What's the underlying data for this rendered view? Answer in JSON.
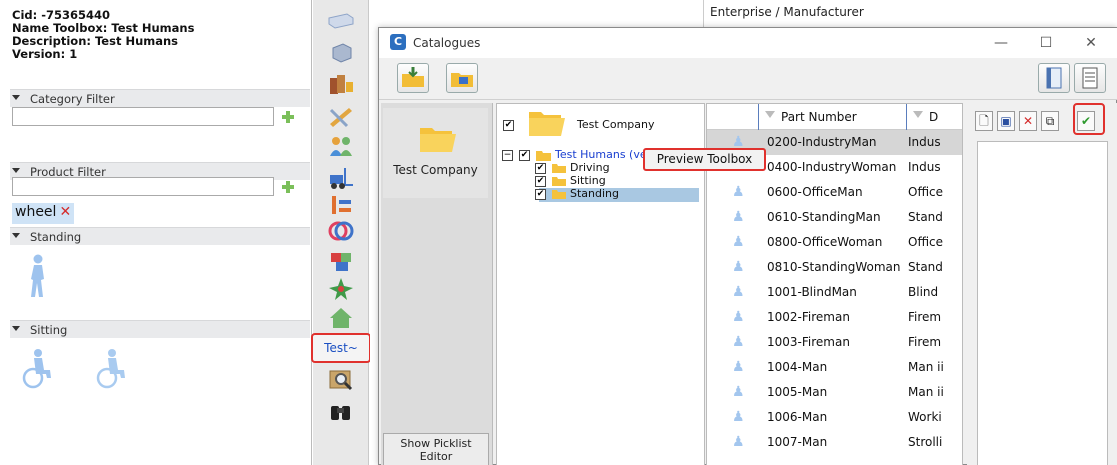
{
  "toolbox": {
    "cid": "Cid: -75365440",
    "name_toolbox": "Name Toolbox: Test Humans",
    "description": "Description: Test Humans",
    "version": "Version: 1",
    "category_filter": "Category Filter",
    "product_filter": "Product Filter",
    "tag": "wheel",
    "standing": "Standing",
    "sitting": "Sitting"
  },
  "strip": {
    "test_tab": "Test~"
  },
  "bg_window": {
    "enterprise": "Enterprise / Manufacturer"
  },
  "catalogues": {
    "title": "Catalogues",
    "minimize": "—",
    "maximize": "☐",
    "close": "✕",
    "company_button": "Test Company",
    "picklist_button_line1": "Show Picklist",
    "picklist_button_line2": "Editor",
    "tree": {
      "root": "Test Company",
      "toolbox": "Test Humans (version 1)",
      "children": [
        "Driving",
        "Sitting",
        "Standing"
      ]
    },
    "context_menu": "Preview Toolbox",
    "grid": {
      "col_part_number": "Part Number",
      "col_desc": "D",
      "rows": [
        {
          "part": "0200-IndustryMan",
          "desc": "Indus"
        },
        {
          "part": "0400-IndustryWoman",
          "desc": "Indus"
        },
        {
          "part": "0600-OfficeMan",
          "desc": "Office"
        },
        {
          "part": "0610-StandingMan",
          "desc": "Stand"
        },
        {
          "part": "0800-OfficeWoman",
          "desc": "Office"
        },
        {
          "part": "0810-StandingWoman",
          "desc": "Stand"
        },
        {
          "part": "1001-BlindMan",
          "desc": "Blind"
        },
        {
          "part": "1002-Fireman",
          "desc": "Firem"
        },
        {
          "part": "1003-Fireman",
          "desc": "Firem"
        },
        {
          "part": "1004-Man",
          "desc": "Man ii"
        },
        {
          "part": "1005-Man",
          "desc": "Man ii"
        },
        {
          "part": "1006-Man",
          "desc": "Worki"
        },
        {
          "part": "1007-Man",
          "desc": "Strolli"
        }
      ]
    }
  }
}
